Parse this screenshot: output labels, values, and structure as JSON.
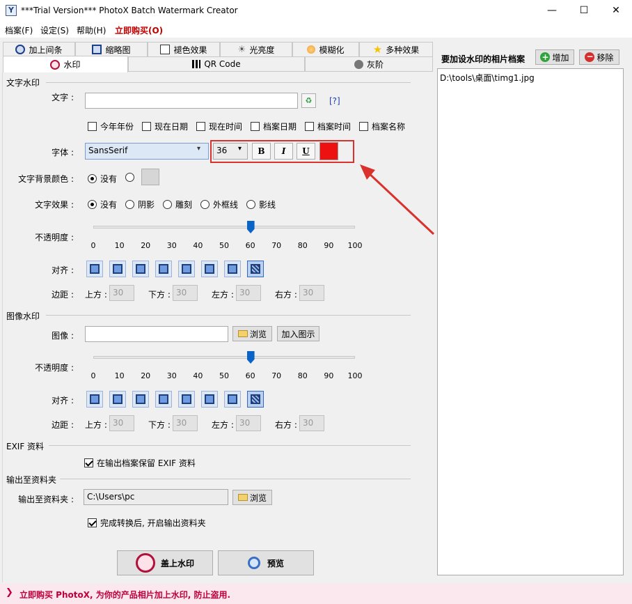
{
  "window": {
    "title": "***Trial Version*** PhotoX Batch Watermark Creator",
    "app_icon": "Y",
    "minimize": "—",
    "maximize": "☐",
    "close": "✕"
  },
  "menu": {
    "file": "档案(F)",
    "settings": "设定(S)",
    "help": "帮助(H)",
    "buy": "立即购买(O)"
  },
  "tabs_top": [
    "加上间条",
    "缩略图",
    "褪色效果",
    "光亮度",
    "模糊化",
    "多种效果"
  ],
  "tabs_bottom": [
    "水印",
    "QR Code",
    "灰阶"
  ],
  "text_watermark": {
    "section": "文字水印",
    "text_label": "文字 :",
    "text_value": "",
    "help_link": "[?]",
    "insert_options": [
      "今年年份",
      "现在日期",
      "现在时间",
      "档案日期",
      "档案时间",
      "档案名称"
    ],
    "font_label": "字体 :",
    "font_value": "SansSerif",
    "size_value": "36",
    "bold": "B",
    "italic": "I",
    "underline": "U",
    "font_color": "#ee1111",
    "bg_label": "文字背景颜色 :",
    "bg_none": "没有",
    "effect_label": "文字效果 :",
    "effects": [
      "没有",
      "阴影",
      "雕刻",
      "外框线",
      "影线"
    ],
    "opacity_label": "不透明度 :",
    "opacity_value": 60,
    "ticks": [
      "0",
      "10",
      "20",
      "30",
      "40",
      "50",
      "60",
      "70",
      "80",
      "90",
      "100"
    ],
    "align_label": "对齐 :",
    "margin_label": "边距 :",
    "top": "上方 :",
    "top_value": "30",
    "bottom": "下方 :",
    "bottom_value": "30",
    "left": "左方 :",
    "left_value": "30",
    "right": "右方 :",
    "right_value": "30"
  },
  "image_watermark": {
    "section": "图像水印",
    "image_label": "图像 :",
    "image_value": "",
    "browse": "浏览",
    "add_pic": "加入图示",
    "opacity_label": "不透明度 :",
    "opacity_value": 60,
    "align_label": "对齐 :",
    "margin_label": "边距 :",
    "top": "上方 :",
    "top_value": "30",
    "bottom": "下方 :",
    "bottom_value": "30",
    "left": "左方 :",
    "left_value": "30",
    "right": "右方 :",
    "right_value": "30"
  },
  "exif": {
    "section": "EXIF 资料",
    "keep": "在输出档案保留 EXIF 资料"
  },
  "output": {
    "section": "输出至资料夹",
    "label": "输出至资料夹 :",
    "value": "C:\\Users\\pc",
    "browse": "浏览",
    "open_after": "完成转换后, 开启输出资料夹"
  },
  "actions": {
    "apply": "盖上水印",
    "preview": "预览"
  },
  "files": {
    "title": "要加设水印的相片档案",
    "add": "增加",
    "remove": "移除",
    "items": [
      "D:\\tools\\桌面\\timg1.jpg"
    ]
  },
  "footer": {
    "promo": "立即购买 PhotoX, 为你的产品相片加上水印, 防止盗用."
  },
  "colors": {
    "accent_red": "#d9312b",
    "menu_buy": "#c00000",
    "footer_text": "#c0003c"
  }
}
